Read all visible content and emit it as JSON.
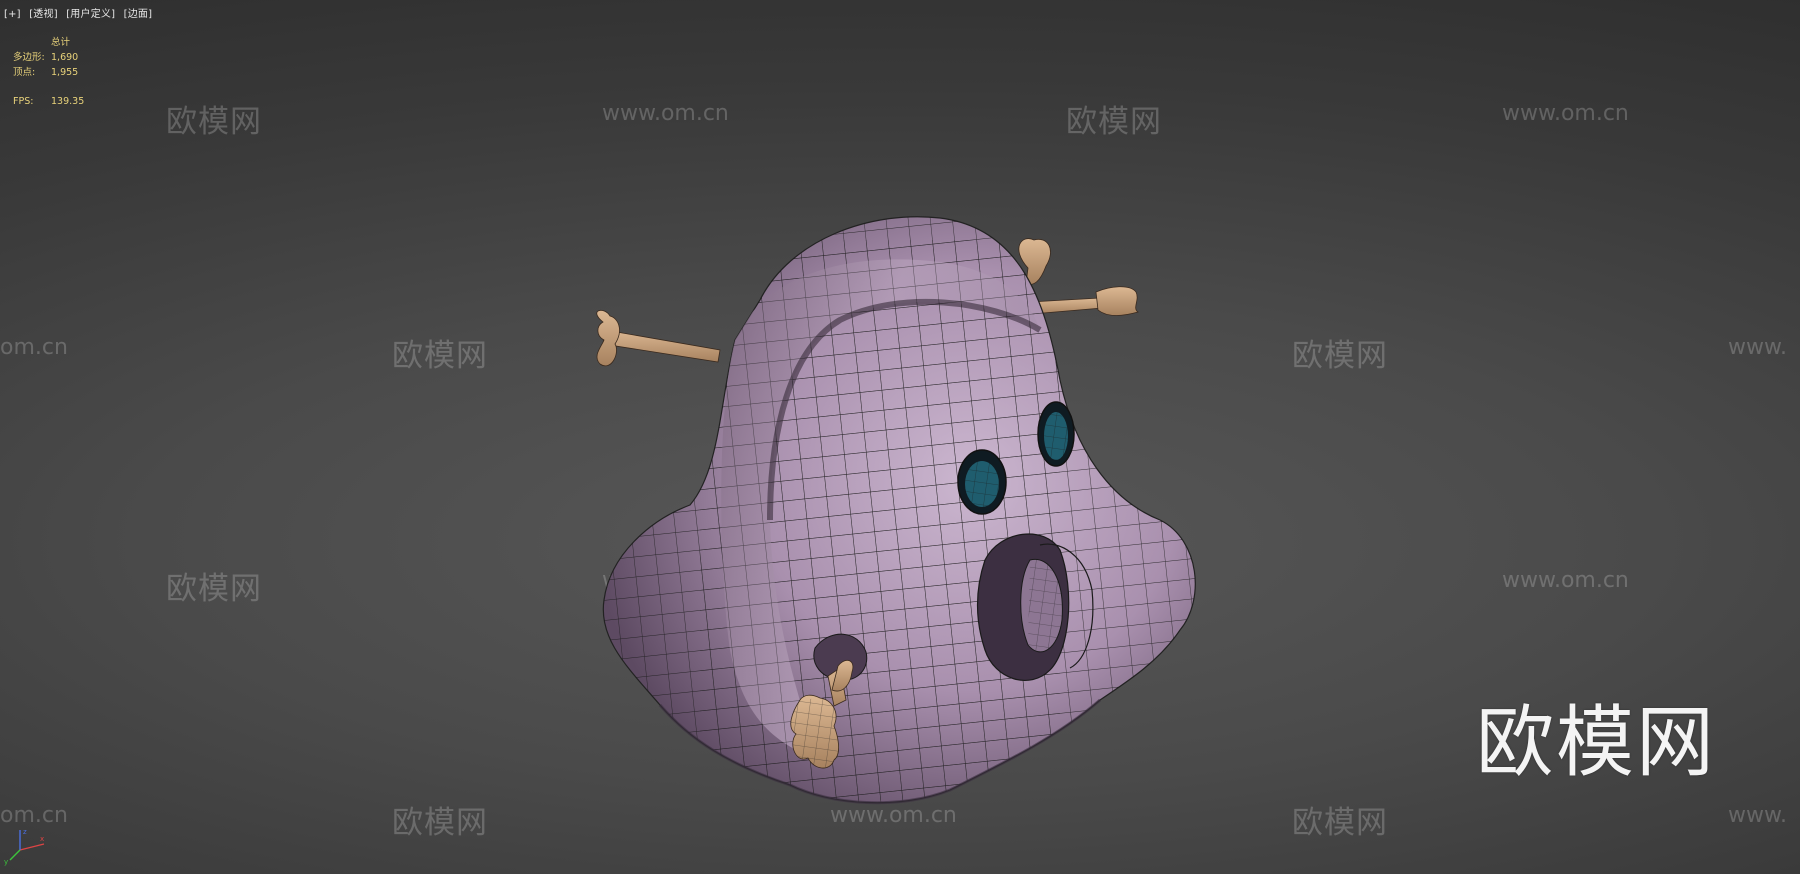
{
  "viewport": {
    "labels": [
      "[+]",
      "[透视]",
      "[用户定义]",
      "[边面]"
    ]
  },
  "stats": {
    "title": "总计",
    "polygons_label": "多边形:",
    "polygons_value": "1,690",
    "vertices_label": "顶点:",
    "vertices_value": "1,955",
    "fps_label": "FPS:",
    "fps_value": "139.35"
  },
  "watermarks": {
    "cn": "欧模网",
    "en": "www.om.cn",
    "en_partial_left": "om.cn",
    "en_partial_right": "www."
  },
  "brand_watermark": "欧模网",
  "colors": {
    "background": "#484848",
    "stats_text": "#e8d27a",
    "model_body": "#b29ab9",
    "bone": "#c9a27a",
    "eye": "#1f5d6e",
    "wireframe": "#1a1a1a"
  },
  "icons": {
    "axis_gizmo": "xyz-axis-icon"
  }
}
